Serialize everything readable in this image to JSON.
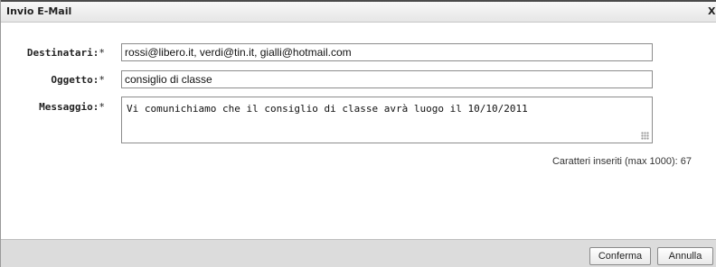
{
  "dialog": {
    "title": "Invio E-Mail",
    "close_label": "X"
  },
  "form": {
    "recipients": {
      "label": "Destinatari:",
      "required_mark": "*",
      "value": "rossi@libero.it, verdi@tin.it, gialli@hotmail.com"
    },
    "subject": {
      "label": "Oggetto:",
      "required_mark": "*",
      "value": "consiglio di classe"
    },
    "message": {
      "label": "Messaggio:",
      "required_mark": "*",
      "value": "Vi comunichiamo che il consiglio di classe avrà luogo il 10/10/2011"
    },
    "counter": "Caratteri inseriti (max 1000): 67"
  },
  "footer": {
    "confirm_label": "Conferma",
    "cancel_label": "Annulla"
  }
}
